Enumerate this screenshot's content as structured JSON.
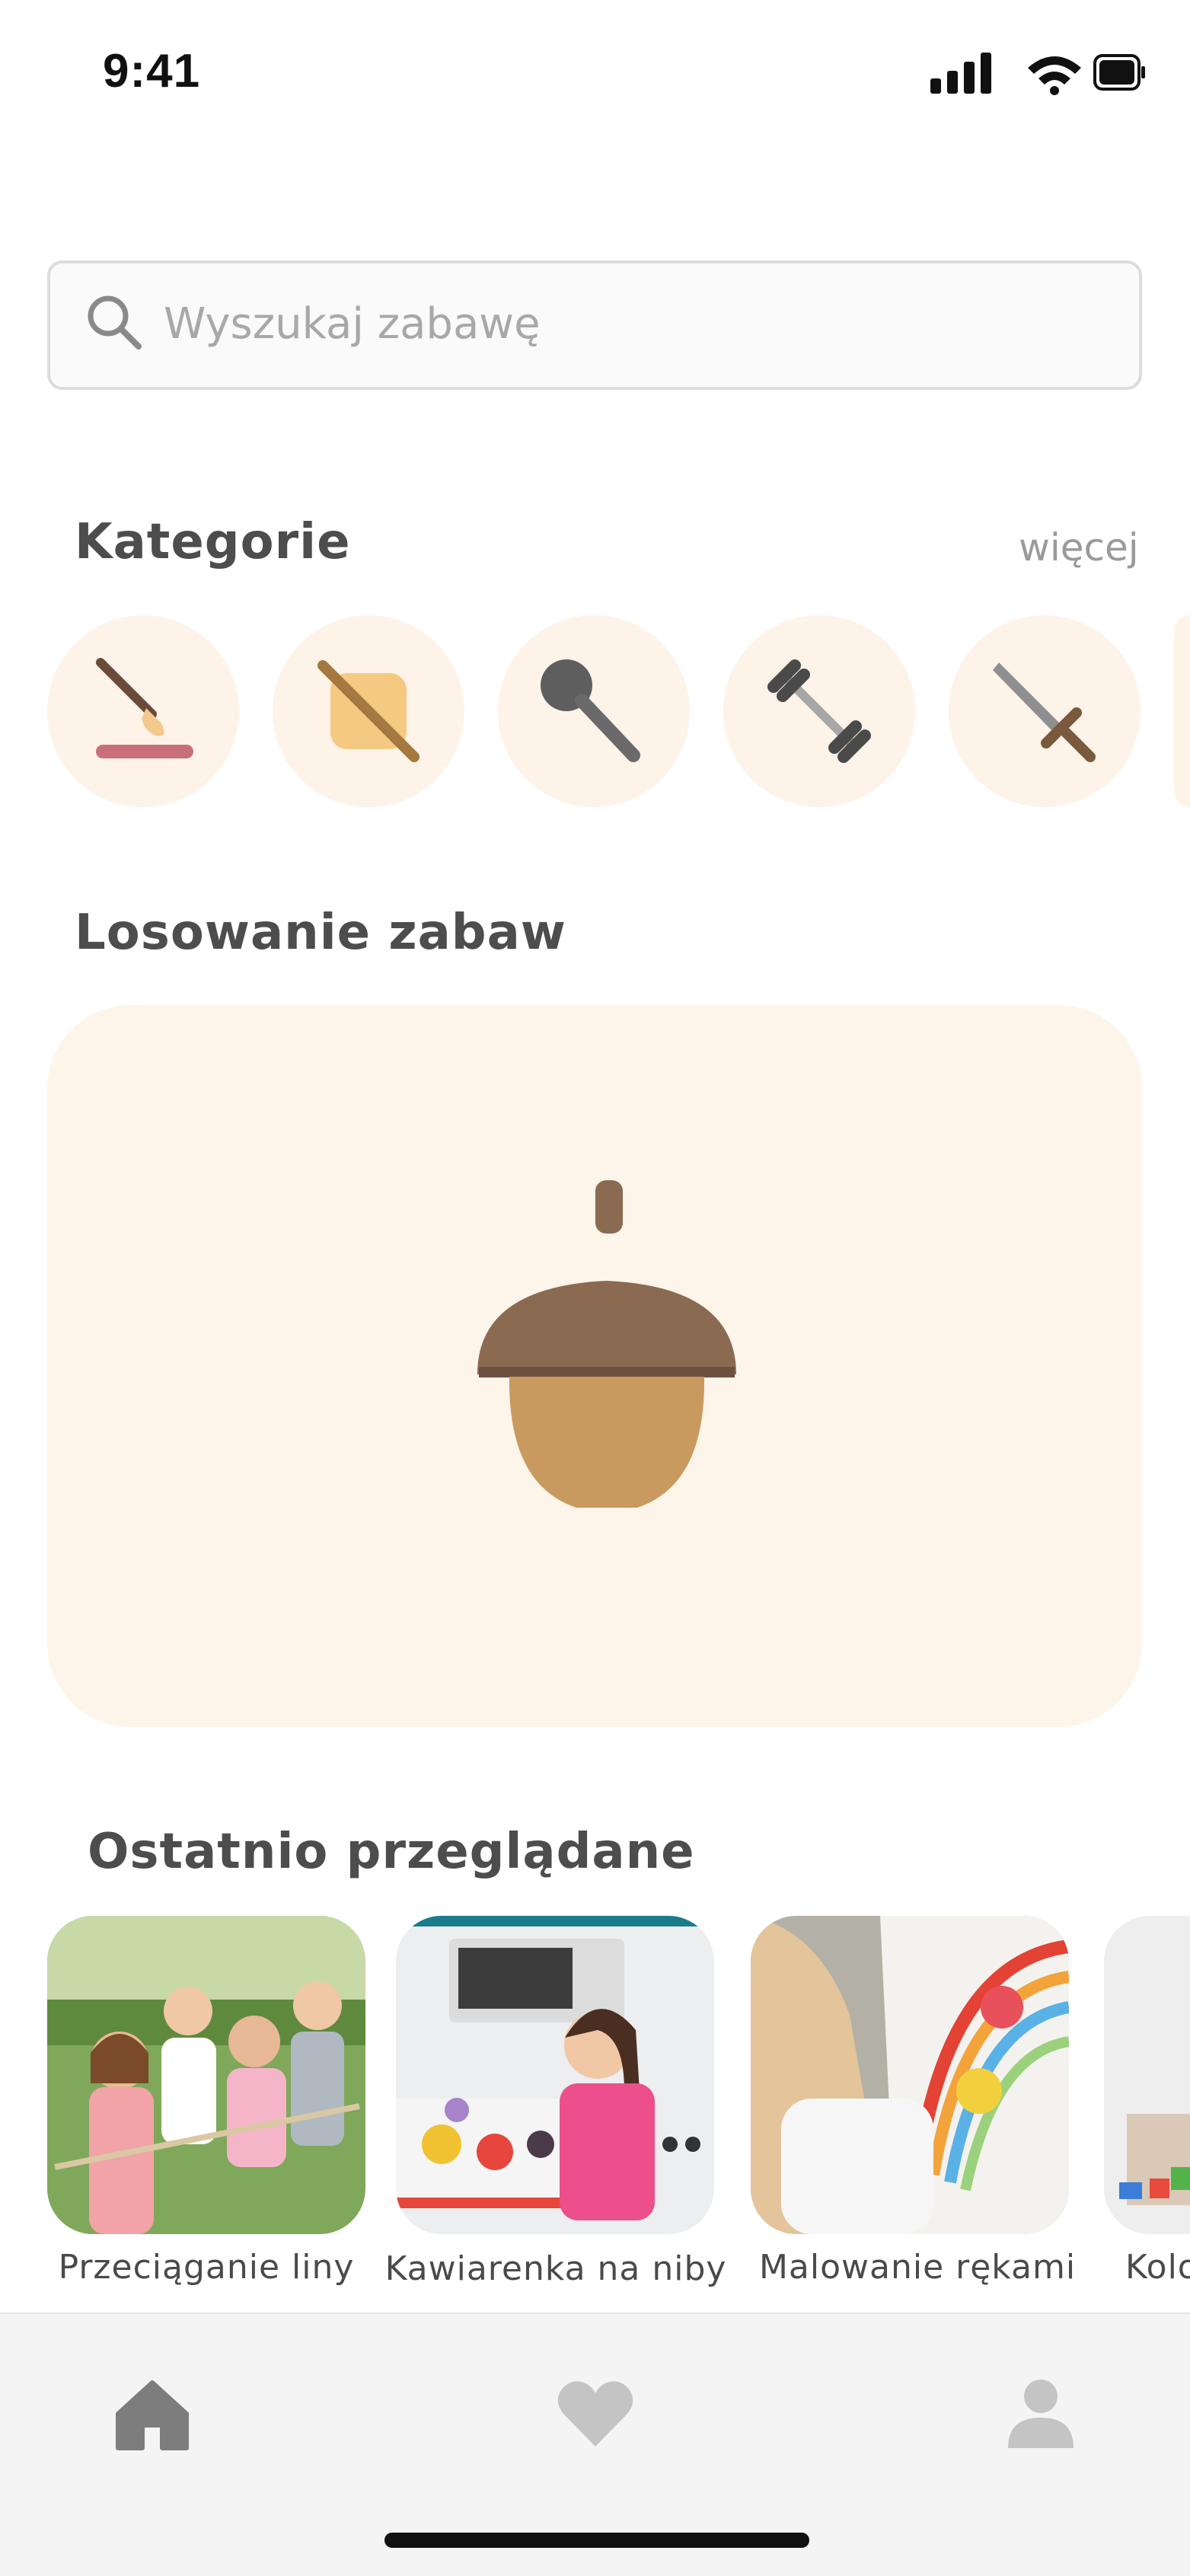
{
  "status_bar": {
    "time": "9:41"
  },
  "search": {
    "placeholder": "Wyszukaj zabawę"
  },
  "categories": {
    "title": "Kategorie",
    "more_label": "więcej",
    "items": [
      {
        "icon": "paintbrush-icon"
      },
      {
        "icon": "rolling-pin-icon"
      },
      {
        "icon": "microphone-icon"
      },
      {
        "icon": "dumbbell-icon"
      },
      {
        "icon": "sword-icon"
      }
    ]
  },
  "random": {
    "title": "Losowanie zabaw",
    "icon": "acorn-icon"
  },
  "recent": {
    "title": "Ostatnio przeglądane",
    "items": [
      {
        "label": "Przeciąganie liny"
      },
      {
        "label": "Kawiarenka na niby"
      },
      {
        "label": "Malowanie rękami"
      },
      {
        "label": "Kolo"
      }
    ]
  },
  "tabbar": {
    "items": [
      {
        "icon": "home-icon",
        "active": true
      },
      {
        "icon": "heart-icon",
        "active": false
      },
      {
        "icon": "profile-icon",
        "active": false
      }
    ]
  },
  "colors": {
    "accent_bg": "#fdf4ea",
    "tab_active": "#7d7d7d",
    "tab_inactive": "#c4c4c4"
  }
}
